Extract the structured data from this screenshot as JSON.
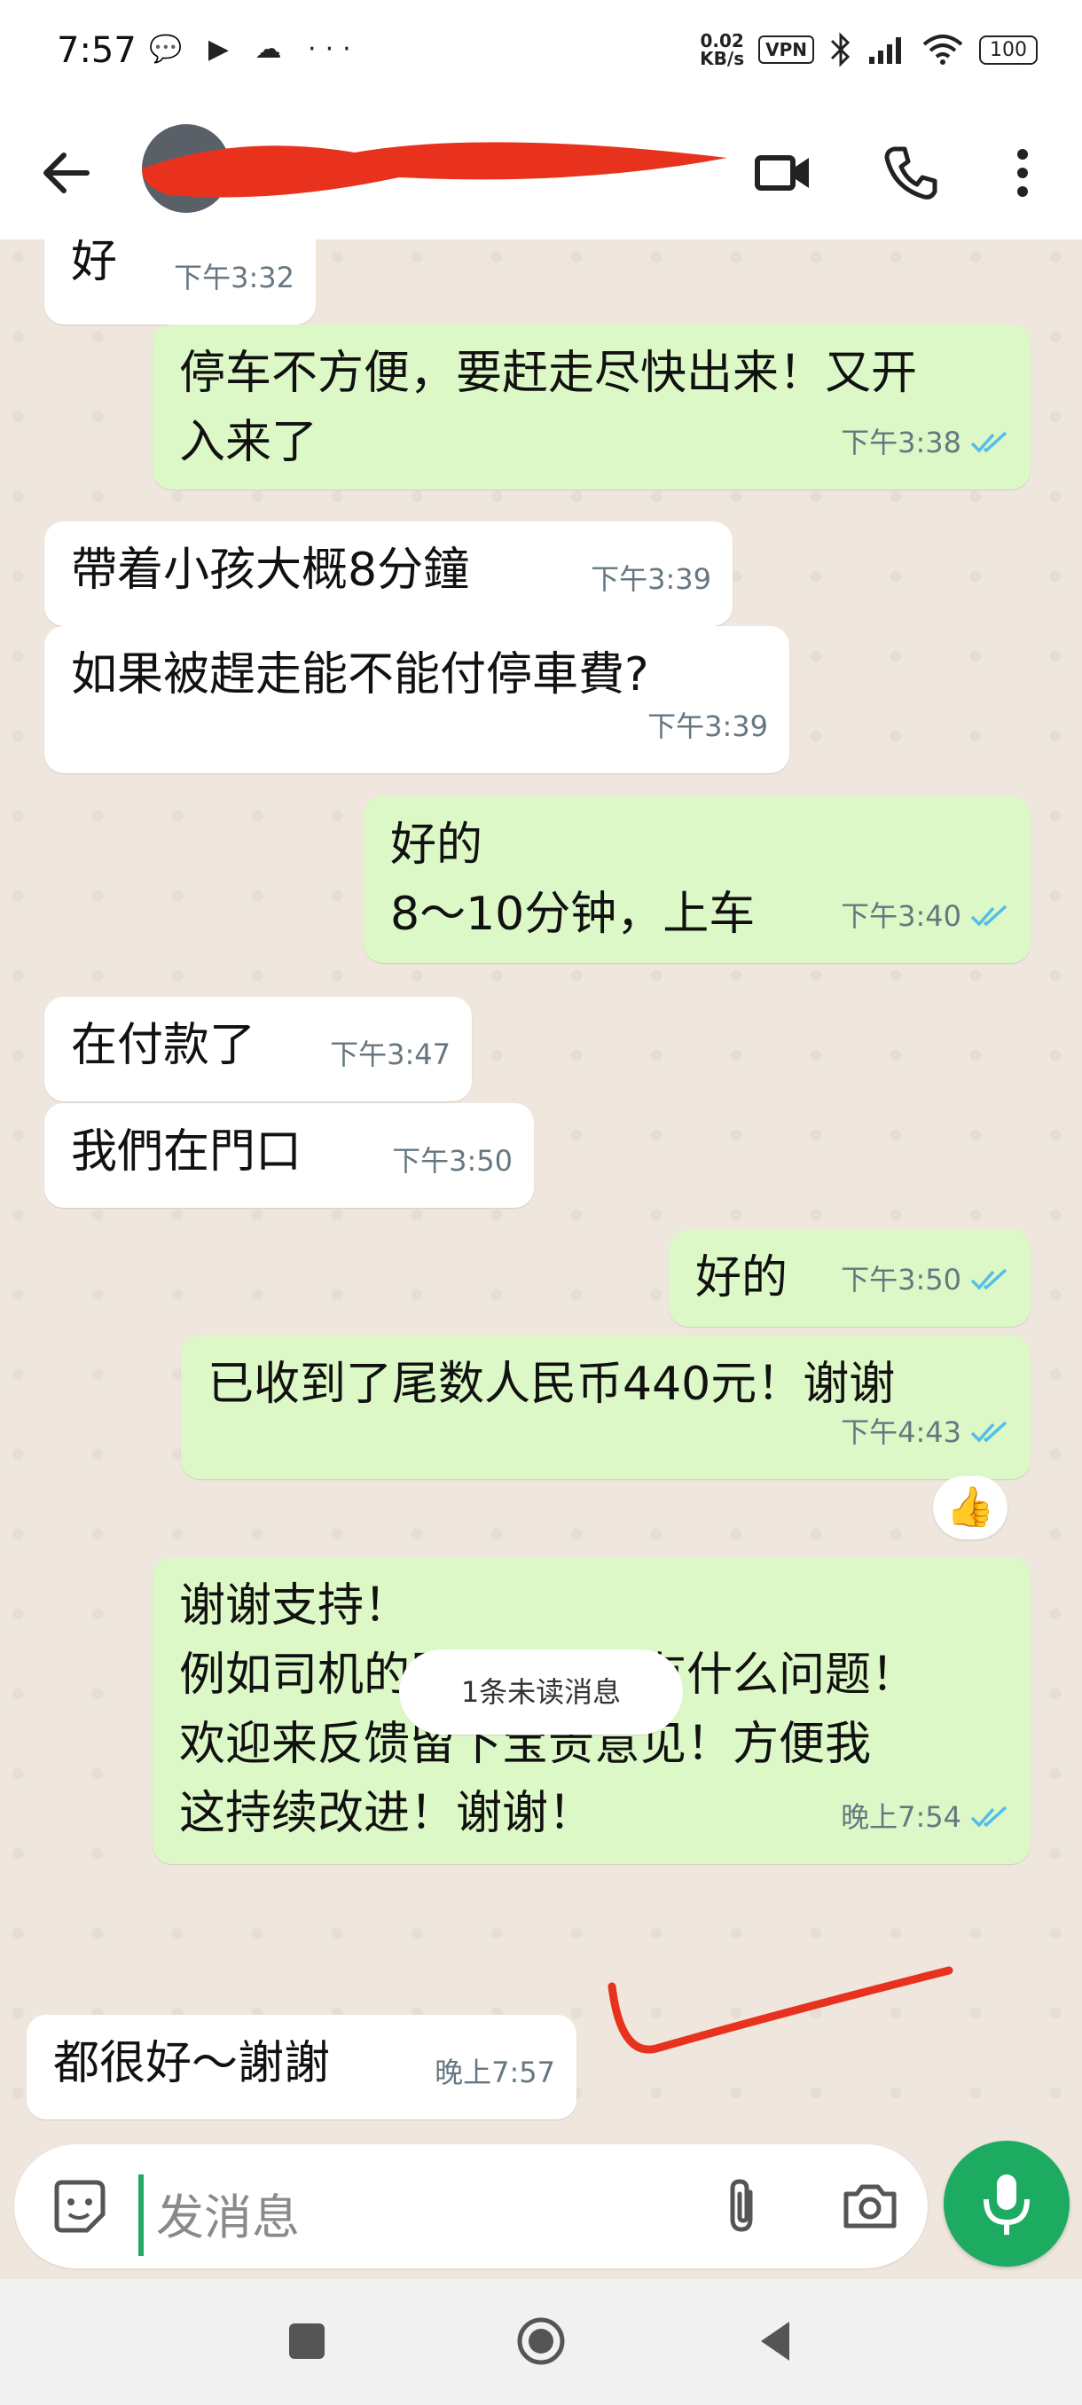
{
  "status_bar": {
    "time": "7:57",
    "left_icons": "💬 ▶ ☁ ···",
    "speed_value": "0.02",
    "speed_unit": "KB/s",
    "vpn": "VPN",
    "battery": "100"
  },
  "input": {
    "placeholder": "发消息"
  },
  "unread_divider": "1条未读消息",
  "messages": [
    {
      "dir": "in",
      "text": "好",
      "time": "下午3:32",
      "ticks": false
    },
    {
      "dir": "out",
      "text": "停车不方便，要赶走尽快出来！又开\n入来了",
      "time": "下午3:38",
      "ticks": true
    },
    {
      "dir": "in",
      "text": "帶着小孩大概8分鐘",
      "time": "下午3:39",
      "ticks": false
    },
    {
      "dir": "in",
      "text": "如果被趕走能不能付停車費?",
      "time": "下午3:39",
      "ticks": false
    },
    {
      "dir": "out",
      "text": "好的\n8～10分钟，上车",
      "time": "下午3:40",
      "ticks": true
    },
    {
      "dir": "in",
      "text": "在付款了",
      "time": "下午3:47",
      "ticks": false
    },
    {
      "dir": "in",
      "text": "我們在門口",
      "time": "下午3:50",
      "ticks": false
    },
    {
      "dir": "out",
      "text": "好的",
      "time": "下午3:50",
      "ticks": true
    },
    {
      "dir": "out",
      "text": "已收到了尾数人民币440元！谢谢",
      "time": "下午4:43",
      "ticks": true,
      "reaction": "👍"
    },
    {
      "dir": "out",
      "text": "谢谢支持！\n例如司机的服务过程！有什么问题！\n欢迎来反馈留下宝贵意见！方便我\n这持续改进！谢谢！",
      "time": "晚上7:54",
      "ticks": true
    },
    {
      "dir": "in",
      "text": "都很好～謝謝",
      "time": "晚上7:57",
      "ticks": false
    }
  ],
  "colors": {
    "outgoing_bubble": "#dcf8c6",
    "incoming_bubble": "#ffffff",
    "read_ticks": "#53bdeb",
    "mic_button": "#1dab61",
    "annotation": "#e8321e"
  }
}
